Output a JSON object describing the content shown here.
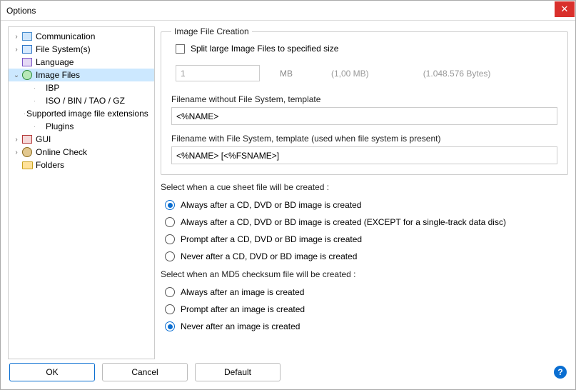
{
  "window": {
    "title": "Options"
  },
  "tree": {
    "items": [
      {
        "label": "Communication",
        "icon": "comm",
        "depth": 0,
        "expander": "›"
      },
      {
        "label": "File System(s)",
        "icon": "fs",
        "depth": 0,
        "expander": "›"
      },
      {
        "label": "Language",
        "icon": "lang",
        "depth": 0,
        "expander": ""
      },
      {
        "label": "Image Files",
        "icon": "img",
        "depth": 0,
        "expander": "⌄",
        "selected": true
      },
      {
        "label": "IBP",
        "icon": "",
        "depth": 1,
        "expander": ""
      },
      {
        "label": "ISO / BIN / TAO / GZ",
        "icon": "",
        "depth": 1,
        "expander": ""
      },
      {
        "label": "Supported image file extensions",
        "icon": "",
        "depth": 1,
        "expander": ""
      },
      {
        "label": "Plugins",
        "icon": "",
        "depth": 1,
        "expander": ""
      },
      {
        "label": "GUI",
        "icon": "gui",
        "depth": 0,
        "expander": "›"
      },
      {
        "label": "Online Check",
        "icon": "online",
        "depth": 0,
        "expander": "›"
      },
      {
        "label": "Folders",
        "icon": "folder",
        "depth": 0,
        "expander": ""
      }
    ]
  },
  "group": {
    "legend": "Image File Creation",
    "split_label": "Split large Image Files to specified size",
    "split_checked": false,
    "split_value": "1",
    "split_unit": "MB",
    "split_hint_mb": "(1,00 MB)",
    "split_hint_bytes": "(1.048.576 Bytes)",
    "tmpl1_label": "Filename without File System, template",
    "tmpl1_value": "<%NAME>",
    "tmpl2_label": "Filename with File System, template (used when file system is present)",
    "tmpl2_value": "<%NAME> [<%FSNAME>]"
  },
  "cue": {
    "heading": "Select when a cue sheet file will be created :",
    "options": [
      "Always after a CD, DVD or BD image is created",
      "Always after a CD, DVD or BD image is created (EXCEPT for a single-track data disc)",
      "Prompt after a CD, DVD or BD image is created",
      "Never after a CD, DVD or BD image is created"
    ],
    "selected": 0
  },
  "md5": {
    "heading": "Select when an MD5 checksum file will be created :",
    "options": [
      "Always after an image is created",
      "Prompt after an image is created",
      "Never after an image is created"
    ],
    "selected": 2
  },
  "buttons": {
    "ok": "OK",
    "cancel": "Cancel",
    "default": "Default"
  }
}
